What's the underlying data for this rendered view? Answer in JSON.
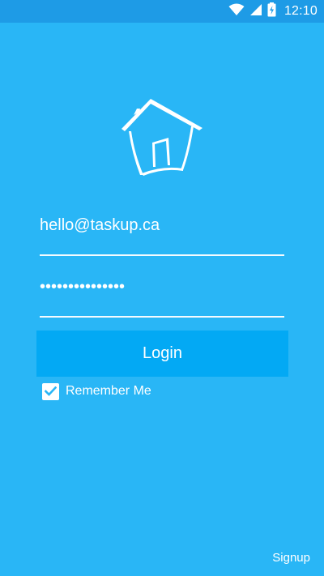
{
  "status_bar": {
    "time": "12:10",
    "icons": [
      "wifi-icon",
      "signal-icon",
      "battery-charging-icon"
    ]
  },
  "logo": {
    "icon": "house-icon"
  },
  "login_form": {
    "email_value": "hello@taskup.ca",
    "password_value": "•••••••••••••••",
    "login_label": "Login",
    "remember_label": "Remember Me",
    "remember_checked": true
  },
  "footer": {
    "signup_label": "Signup"
  },
  "colors": {
    "background": "#29b6f6",
    "status_bar": "#1e9be6",
    "button": "#03a9f4",
    "text": "#ffffff"
  }
}
